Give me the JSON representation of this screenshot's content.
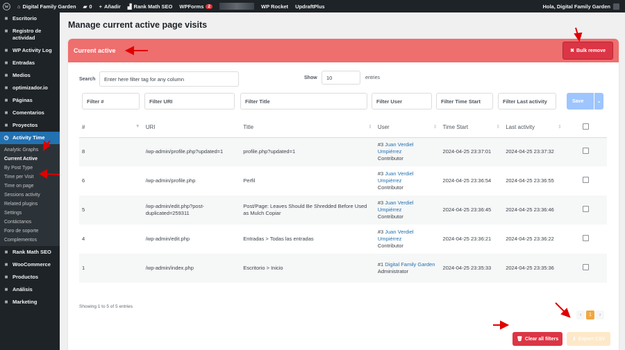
{
  "adminbar": {
    "site_name": "Digital Family Garden",
    "comments_count": "0",
    "add_new": "Añadir",
    "rank_math": "Rank Math SEO",
    "wpforms": "WPForms",
    "wpforms_badge": "2",
    "wp_rocket": "WP Rocket",
    "updraftplus": "UpdraftPlus",
    "greeting": "Hola, Digital Family Garden"
  },
  "sidebar": {
    "items_top": [
      {
        "label": "Escritorio",
        "icon": "dashboard-icon"
      },
      {
        "label": "Registro de actividad",
        "icon": "activity-log-icon"
      },
      {
        "label": "WP Activity Log",
        "icon": "eye-icon"
      },
      {
        "label": "Entradas",
        "icon": "pin-icon"
      },
      {
        "label": "Medios",
        "icon": "media-icon"
      },
      {
        "label": "optimizador.io",
        "icon": "optimizer-icon"
      },
      {
        "label": "Páginas",
        "icon": "page-icon"
      },
      {
        "label": "Comentarios",
        "icon": "comment-icon"
      },
      {
        "label": "Proyectos",
        "icon": "pin-icon"
      }
    ],
    "active_item": {
      "label": "Activity Time",
      "icon": "clock-icon"
    },
    "submenu": [
      "Analytic Graphs",
      "Current Active",
      "By Post Type",
      "Time per Visit",
      "Time on page",
      "Sessions activity",
      "Related plugins",
      "Settings",
      "Contáctanos",
      "Foro de soporte",
      "Complementos"
    ],
    "current_submenu_index": 1,
    "items_bottom": [
      {
        "label": "Rank Math SEO",
        "icon": "rank-math-icon"
      },
      {
        "label": "WooCommerce",
        "icon": "woo-icon"
      },
      {
        "label": "Productos",
        "icon": "products-icon"
      },
      {
        "label": "Análisis",
        "icon": "analytics-icon"
      },
      {
        "label": "Marketing",
        "icon": "megaphone-icon"
      }
    ]
  },
  "page": {
    "title": "Manage current active page visits",
    "panel_title": "Current active",
    "bulk_remove": "Bulk remove",
    "search_label": "Search",
    "search_placeholder": "Enter here filter tag for any column",
    "show_label": "Show",
    "show_value": "10",
    "entries_label": "entries",
    "filters": [
      "Filter #",
      "Filter URI",
      "Filter Title",
      "Filter User",
      "Filter Time Start",
      "Filter Last activity"
    ],
    "save_label": "Save",
    "info": "Showing 1 to 5 of 5 entries",
    "pagination": {
      "prev": "‹",
      "current": "1",
      "next": "›"
    },
    "clear_filters": "Clear all filters",
    "export_csv": "Export CSV"
  },
  "table": {
    "headers": {
      "num": "#",
      "uri": "URI",
      "title": "Title",
      "user": "User",
      "time_start": "Time Start",
      "last_activity": "Last activity"
    },
    "rows": [
      {
        "num": "8",
        "uri": "/wp-admin/profile.php?updated=1",
        "title": "profile.php?updated=1",
        "user_id": "#3",
        "user_name": "Juan Verdiel Umpiérrez",
        "role": "Contributor",
        "time_start": "2024-04-25 23:37:01",
        "last_activity": "2024-04-25 23:37:32",
        "late": false
      },
      {
        "num": "6",
        "uri": "/wp-admin/profile.php",
        "title": "Perfil",
        "user_id": "#3",
        "user_name": "Juan Verdiel Umpiérrez",
        "role": "Contributor",
        "time_start": "2024-04-25 23:36:54",
        "last_activity": "2024-04-25 23:36:55",
        "late": false
      },
      {
        "num": "5",
        "uri": "/wp-admin/edit.php?post-duplicated=259311",
        "title": "Post/Page: Leaves Should Be Shredded Before Used as Mulch Copiar",
        "user_id": "#3",
        "user_name": "Juan Verdiel Umpiérrez",
        "role": "Contributor",
        "time_start": "2024-04-25 23:36:45",
        "last_activity": "2024-04-25 23:36:46",
        "late": true
      },
      {
        "num": "4",
        "uri": "/wp-admin/edit.php",
        "title": "Entradas > Todas las entradas",
        "user_id": "#3",
        "user_name": "Juan Verdiel Umpiérrez",
        "role": "Contributor",
        "time_start": "2024-04-25 23:36:21",
        "last_activity": "2024-04-25 23:36:22",
        "late": true
      },
      {
        "num": "1",
        "uri": "/wp-admin/index.php",
        "title": "Escritorio > Inicio",
        "user_id": "#1",
        "user_name": "Digital Family Garden",
        "role": "Administrator",
        "time_start": "2024-04-25 23:35:33",
        "last_activity": "2024-04-25 23:35:36",
        "late": true
      }
    ]
  },
  "colors": {
    "accent": "#2271b1",
    "header_red": "#ef6e6e",
    "danger": "#dc3545",
    "annotation_arrow": "#e00000"
  }
}
